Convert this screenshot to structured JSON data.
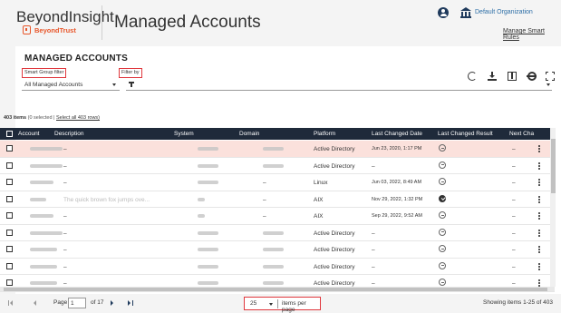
{
  "header": {
    "brand": "BeyondInsight",
    "brand_sub": "BeyondTrust",
    "title": "Managed Accounts",
    "org_link": "Default Organization",
    "smart_rules_link": "Manage Smart Rules"
  },
  "panel": {
    "title": "MANAGED ACCOUNTS",
    "smart_group_label": "Smart Group filter",
    "filter_by_label": "Filter by",
    "smart_group_value": "All Managed Accounts"
  },
  "toolbar": {
    "icons": [
      "refresh-icon",
      "download-icon",
      "columns-icon",
      "gear-icon",
      "expand-icon"
    ]
  },
  "summary": {
    "count": "403 items",
    "selected": "(0 selected |",
    "select_all": "Select all 403 rows)"
  },
  "table": {
    "columns": [
      "Account",
      "Description",
      "System",
      "Domain",
      "Platform",
      "Last Changed Date",
      "Last Changed Result",
      "Next Cha"
    ],
    "rows": [
      {
        "platform": "Active Directory",
        "date": "Jun 23, 2020, 1:17 PM",
        "next": "–",
        "result": "minus",
        "desc": "–"
      },
      {
        "platform": "Active Directory",
        "date": "–",
        "next": "–",
        "result": "minus",
        "desc": "–"
      },
      {
        "platform": "Linux",
        "date": "Jun 03, 2022, 8:49 AM",
        "next": "–",
        "result": "minus",
        "desc": "–"
      },
      {
        "platform": "AIX",
        "date": "Nov 29, 2022, 1:32 PM",
        "next": "–",
        "result": "ok",
        "desc": "The quick brown fox jumps ove..."
      },
      {
        "platform": "AIX",
        "date": "Sep 29, 2022, 9:52 AM",
        "next": "–",
        "result": "minus",
        "desc": "–"
      },
      {
        "platform": "Active Directory",
        "date": "–",
        "next": "–",
        "result": "minus",
        "desc": "–"
      },
      {
        "platform": "Active Directory",
        "date": "–",
        "next": "–",
        "result": "minus",
        "desc": "–"
      },
      {
        "platform": "Active Directory",
        "date": "–",
        "next": "–",
        "result": "minus",
        "desc": "–"
      },
      {
        "platform": "Active Directory",
        "date": "–",
        "next": "–",
        "result": "minus",
        "desc": "–"
      }
    ]
  },
  "pager": {
    "page_label": "Page",
    "page_value": "1",
    "of_label": "of 17",
    "per_page_value": "25",
    "per_page_label": "items per page",
    "showing": "Showing items 1-25 of 403"
  },
  "colors": {
    "header_bg": "#1f2a3a",
    "highlight_row": "#fbe1dc",
    "brand_orange": "#e8562a",
    "callout_red": "#e0383e"
  }
}
